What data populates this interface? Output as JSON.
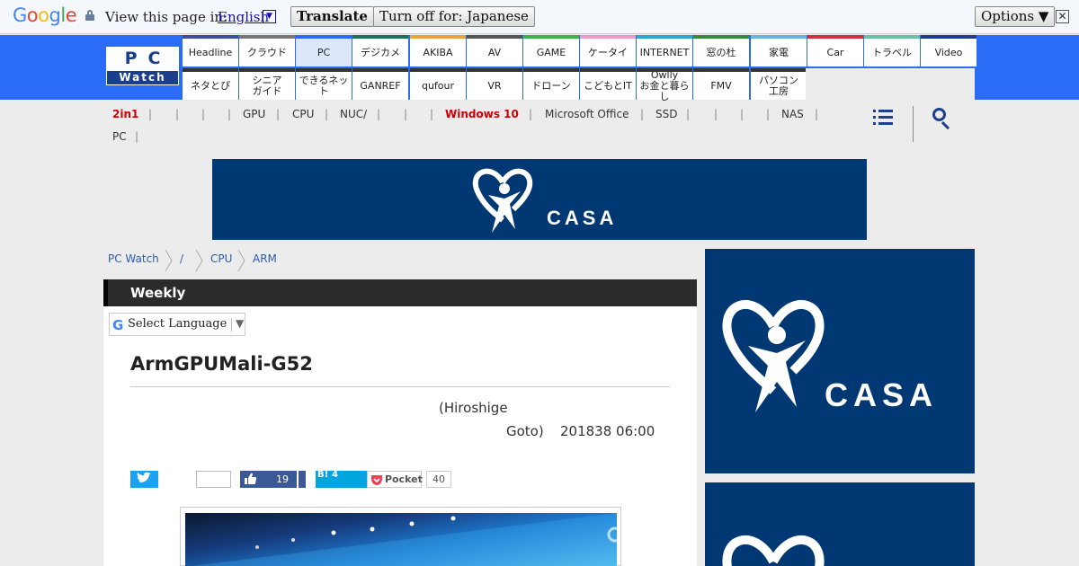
{
  "translate_bar": {
    "logo": "Google",
    "prompt": "View this page in:",
    "language": "English",
    "translate_label": "Translate",
    "turn_off_label": "Turn off for: Japanese",
    "options_label": "Options ▼",
    "close_label": "✕"
  },
  "site": {
    "logo_top": "PC",
    "logo_bottom": "Watch"
  },
  "nav_row1": [
    {
      "label": "Headline",
      "color": "#3c4fa0"
    },
    {
      "label": "クラウド",
      "color": "#777777"
    },
    {
      "label": "PC",
      "color": "#2a6cf6"
    },
    {
      "label": "デジカメ",
      "color": "#1f6f5a"
    },
    {
      "label": "AKIBA",
      "color": "#e8a53c"
    },
    {
      "label": "AV",
      "color": "#555555"
    },
    {
      "label": "GAME",
      "color": "#40b04a"
    },
    {
      "label": "ケータイ",
      "color": "#e79ec1"
    },
    {
      "label": "INTERNET",
      "color": "#2fa7c9"
    },
    {
      "label": "窓の杜",
      "color": "#3a8a3a"
    },
    {
      "label": "家電",
      "color": "#6eb3e0"
    },
    {
      "label": "Car",
      "color": "#d03040"
    },
    {
      "label": "トラベル",
      "color": "#6fbfa5"
    },
    {
      "label": "Video",
      "color": "#1b3f8d"
    }
  ],
  "nav_row2": [
    {
      "label": "ネタとぴ"
    },
    {
      "label": "シニア\nガイド"
    },
    {
      "label": "できるネット"
    },
    {
      "label": "GANREF"
    },
    {
      "label": "qufour"
    },
    {
      "label": "VR"
    },
    {
      "label": "ドローン"
    },
    {
      "label": "こどもとIT"
    },
    {
      "label": "Owlly\nお金と暮らし"
    },
    {
      "label": "FMV"
    },
    {
      "label": "パソコン\n工房"
    }
  ],
  "tags_row1": [
    "2in1",
    "",
    "",
    "",
    "",
    "GPU",
    "CPU",
    "NUC/",
    "",
    "",
    "Windows 10",
    "Microsoft Office",
    "SSD",
    "",
    "",
    "",
    "NAS",
    ""
  ],
  "tags_row2": [
    "PC"
  ],
  "ads": {
    "brand": "CASA"
  },
  "breadcrumb": [
    "PC Watch",
    "/",
    "CPU",
    "ARM"
  ],
  "article": {
    "section": "Weekly",
    "select_language": "Select Language",
    "title": "ArmGPUMali-G52",
    "author_line1": "(Hiroshige",
    "author_line2": "Goto)",
    "date": "201838 06:00"
  },
  "share": {
    "facebook_count": "19",
    "hatena_label": "B!",
    "hatena_count": "4",
    "pocket_label": "Pocket",
    "pocket_count": "40"
  }
}
